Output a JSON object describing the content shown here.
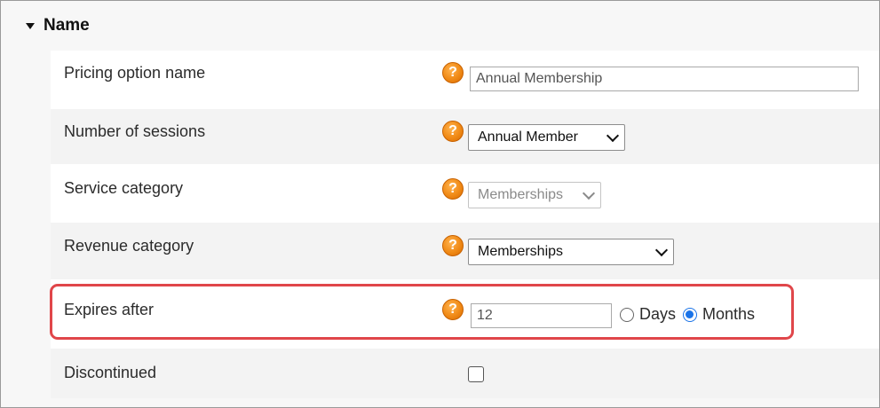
{
  "section": {
    "title": "Name"
  },
  "rows": [
    {
      "label": "Pricing option name",
      "input_value": "Annual Membership"
    },
    {
      "label": "Number of sessions",
      "selected": "Annual Member"
    },
    {
      "label": "Service category",
      "selected": "Memberships"
    },
    {
      "label": "Revenue category",
      "selected": "Memberships"
    },
    {
      "label": "Expires after",
      "input_value": "12",
      "radio_days": "Days",
      "radio_months": "Months",
      "selected_unit": "Months"
    },
    {
      "label": "Discontinued",
      "checked": false
    }
  ],
  "help_glyph": "?",
  "icons": {
    "help": "help-question-icon",
    "dropdown": "chevron-down-icon",
    "section": "triangle-down-icon"
  },
  "colors": {
    "highlight": "#e0464a",
    "radio_accent": "#1a73e8",
    "help": "#f08a16"
  }
}
